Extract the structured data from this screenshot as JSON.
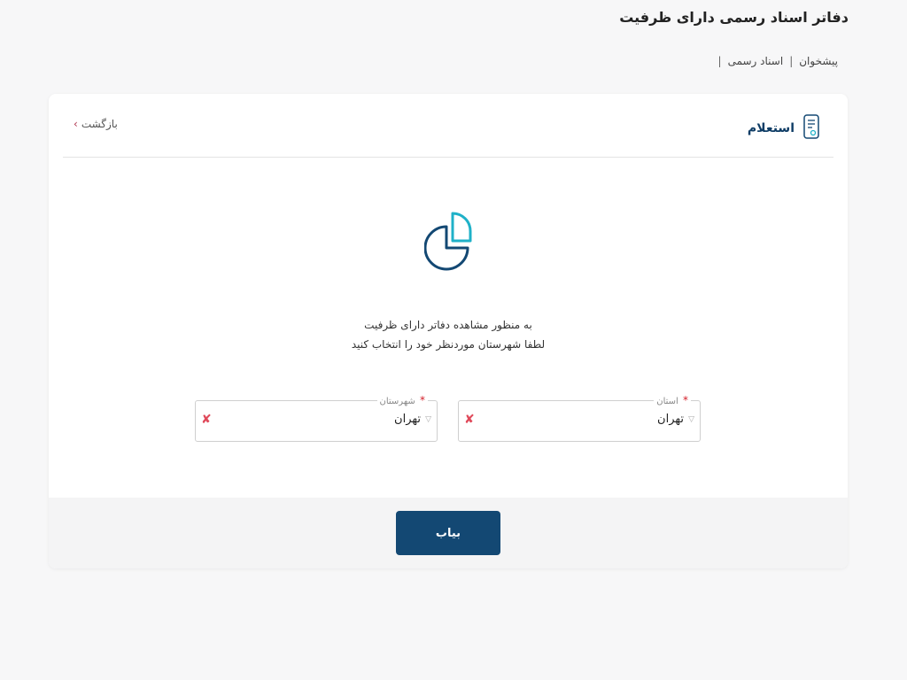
{
  "page": {
    "title": "دفاتر اسناد رسمی دارای ظرفیت"
  },
  "breadcrumb": {
    "items": [
      "پیشخوان",
      "اسناد رسمی"
    ],
    "separator": "|"
  },
  "card": {
    "header_title": "استعلام",
    "back_label": "بازگشت",
    "intro_line1": "به منظور مشاهده دفاتر دارای ظرفیت",
    "intro_line2": "لطفا شهرستان موردنظر خود را انتخاب کنید"
  },
  "fields": {
    "province": {
      "label": "استان",
      "required_mark": "*",
      "value": "تهران",
      "arrow": "▽",
      "clear": "✘"
    },
    "city": {
      "label": "شهرستان",
      "required_mark": "*",
      "value": "تهران",
      "arrow": "▽",
      "clear": "✘"
    }
  },
  "footer": {
    "submit_label": "بیاب"
  },
  "icons": {
    "header_icon": "document-icon",
    "hero_icon": "pie-chart-icon",
    "back_icon": "chevron-right-icon"
  },
  "colors": {
    "primary": "#134873",
    "accent": "#1fb1c8",
    "danger": "#d4202a"
  }
}
